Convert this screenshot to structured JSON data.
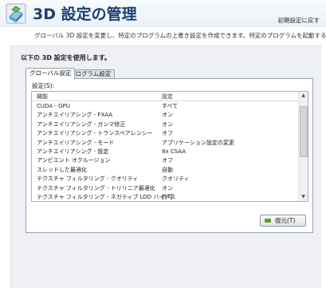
{
  "header": {
    "title": "3D 設定の管理",
    "restore_defaults_link": "初期設定に戻す"
  },
  "description": "グローバル 3D 設定を変更し、特定のプログラムの上書き設定を作成できます。特定のプログラムを起動するたびに、上書き設定が自動",
  "section_title": "以下の 3D 設定を使用します。",
  "tabs": [
    {
      "label": "グローバル設定"
    },
    {
      "label": "プログラム設定"
    }
  ],
  "settings_label": "設定(S):",
  "columns": {
    "feature": "機能",
    "setting": "設定"
  },
  "rows": [
    {
      "feature": "CUDA - GPU",
      "setting": "すべて"
    },
    {
      "feature": "アンチエイリアシング - FXAA",
      "setting": "オン"
    },
    {
      "feature": "アンチエイリアシング - ガンマ修正",
      "setting": "オン"
    },
    {
      "feature": "アンチエイリアシング - トランスペアレンシー",
      "setting": "オフ"
    },
    {
      "feature": "アンチエイリアシング - モード",
      "setting": "アプリケーション設定の変更"
    },
    {
      "feature": "アンチエイリアシング - 設定",
      "setting": "8x CSAA"
    },
    {
      "feature": "アンビエント オクルージョン",
      "setting": "オフ"
    },
    {
      "feature": "スレッドした最適化",
      "setting": "自動"
    },
    {
      "feature": "テクスチャ フィルタリング - クオリティ",
      "setting": "クオリティ"
    },
    {
      "feature": "テクスチャ フィルタリング - トリリニア最適化",
      "setting": "オン"
    },
    {
      "feature": "テクスチャ フィルタリング - ネガティブ LOD バイアス",
      "setting": "許可"
    }
  ],
  "restore_button": "復元(T)",
  "colors": {
    "title": "#1b3f73",
    "panel_background": "#eef0f3",
    "nvidia_green": "#5aa02c"
  }
}
